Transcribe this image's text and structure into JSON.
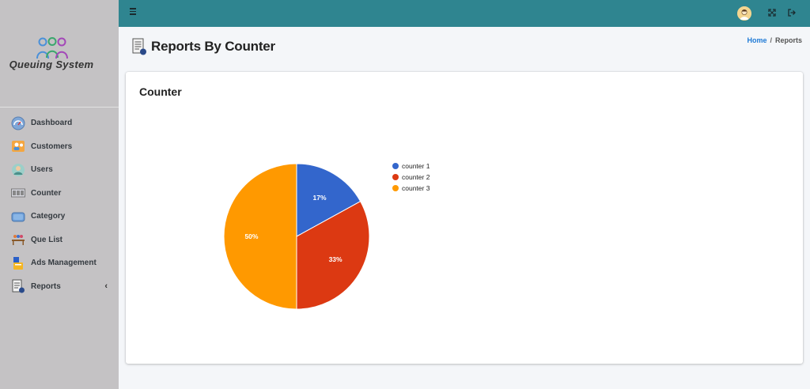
{
  "brand": {
    "name": "Queuing System"
  },
  "sidebar": {
    "items": [
      {
        "label": "Dashboard",
        "icon": "dashboard-icon"
      },
      {
        "label": "Customers",
        "icon": "customers-icon"
      },
      {
        "label": "Users",
        "icon": "users-icon"
      },
      {
        "label": "Counter",
        "icon": "counter-icon"
      },
      {
        "label": "Category",
        "icon": "category-icon"
      },
      {
        "label": "Que List",
        "icon": "que-list-icon"
      },
      {
        "label": "Ads Management",
        "icon": "ads-management-icon"
      },
      {
        "label": "Reports",
        "icon": "reports-icon"
      }
    ],
    "reports_chevron": "‹"
  },
  "header": {
    "title": "Reports By Counter",
    "breadcrumb": {
      "home": "Home",
      "separator": "/",
      "current": "Reports"
    }
  },
  "card": {
    "title": "Counter"
  },
  "chart_data": {
    "type": "pie",
    "title": "",
    "labels": [
      "counter 1",
      "counter 2",
      "counter 3"
    ],
    "values": [
      17,
      33,
      50
    ],
    "value_labels": [
      "17%",
      "33%",
      "50%"
    ],
    "colors": [
      "#3366cc",
      "#dc3912",
      "#ff9900"
    ],
    "legend": "right"
  },
  "colors": {
    "topbar": "#2f8590",
    "sidebar": "#c4c2c4",
    "link": "#1e7ad6"
  }
}
